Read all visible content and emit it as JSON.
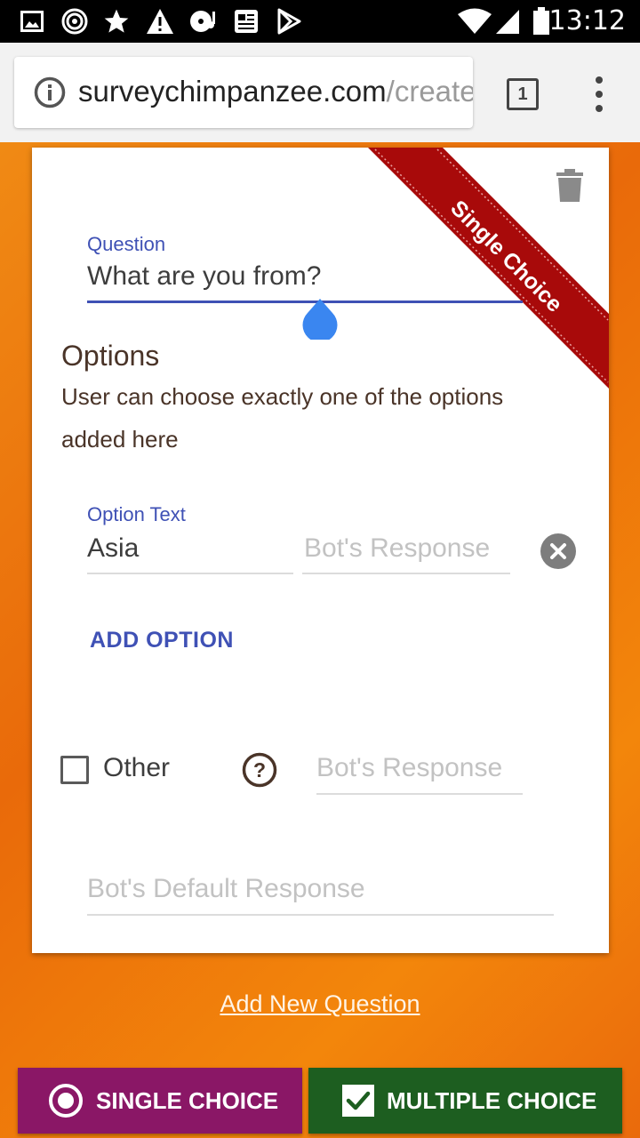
{
  "status_bar": {
    "time": "13:12",
    "icons": [
      "image-icon",
      "hotspot-icon",
      "star-icon",
      "warning-icon",
      "disc-icon",
      "news-icon",
      "play-store-icon",
      "wifi-icon",
      "signal-icon",
      "battery-icon"
    ]
  },
  "browser": {
    "url_domain": "surveychimpanzee.com",
    "url_path": "/create",
    "tab_count": "1"
  },
  "card": {
    "ribbon": "Single Choice",
    "question_label": "Question",
    "question_value": "What are you from?",
    "options_title": "Options",
    "options_description": "User can choose exactly one of the options added here",
    "option": {
      "label": "Option Text",
      "value": "Asia",
      "bot_response_placeholder": "Bot's Response"
    },
    "add_option": "ADD OPTION",
    "other": {
      "label": "Other",
      "checked": false,
      "bot_response_placeholder": "Bot's Response"
    },
    "default_response_placeholder": "Bot's Default Response"
  },
  "add_new_question": "Add New Question",
  "buttons": {
    "single_choice": "SINGLE CHOICE",
    "multiple_choice": "MULTIPLE CHOICE"
  },
  "colors": {
    "accent_blue": "#3f51b5",
    "ribbon_red": "#a80a0a",
    "single_choice_bg": "#8a1766",
    "multiple_choice_bg": "#1d5e20",
    "background_orange": "#e96a0a"
  }
}
